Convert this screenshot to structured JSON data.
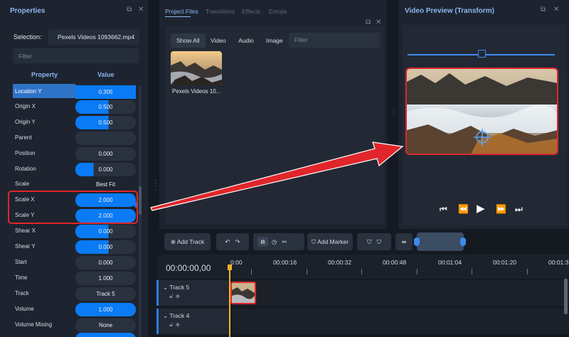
{
  "properties": {
    "title": "Properties",
    "selection_label": "Selection:",
    "selection_value": "Pexels Videos 1093662.mp4",
    "filter_placeholder": "Filter",
    "col_property": "Property",
    "col_value": "Value",
    "rows": [
      {
        "name": "Location Y",
        "value": "0.305"
      },
      {
        "name": "Origin X",
        "value": "0.500"
      },
      {
        "name": "Origin Y",
        "value": "0.500"
      },
      {
        "name": "Parent",
        "value": ""
      },
      {
        "name": "Position",
        "value": "0.000"
      },
      {
        "name": "Rotation",
        "value": "0.000"
      },
      {
        "name": "Scale",
        "value": "Best Fit"
      },
      {
        "name": "Scale X",
        "value": "2.000"
      },
      {
        "name": "Scale Y",
        "value": "2.000"
      },
      {
        "name": "Shear X",
        "value": "0.000"
      },
      {
        "name": "Shear Y",
        "value": "0.000"
      },
      {
        "name": "Start",
        "value": "0.000"
      },
      {
        "name": "Time",
        "value": "1.000"
      },
      {
        "name": "Track",
        "value": "Track 5"
      },
      {
        "name": "Volume",
        "value": "1.000"
      },
      {
        "name": "Volume Mixing",
        "value": "None"
      }
    ]
  },
  "project_files": {
    "tabs": [
      "Project Files",
      "Transitions",
      "Effects",
      "Emojis"
    ],
    "filters": [
      "Show All",
      "Video",
      "Audio",
      "Image"
    ],
    "search_placeholder": "Filter",
    "file_label": "Pexels Videos 10..."
  },
  "preview": {
    "title": "Video Preview (Transform)"
  },
  "toolbar": {
    "add_track": "Add Track",
    "add_marker": "Add Marker"
  },
  "timeline": {
    "timecode": "00:00:00,00",
    "ticks": [
      "0:00",
      "00:00:16",
      "00:00:32",
      "00:00:48",
      "00:01:04",
      "00:01:20",
      "00:01:3"
    ],
    "tracks": [
      {
        "name": "Track 5"
      },
      {
        "name": "Track 4"
      }
    ]
  },
  "colors": {
    "accent": "#0a7bf5",
    "highlight": "#e0262b",
    "playhead": "#f2b42a"
  }
}
